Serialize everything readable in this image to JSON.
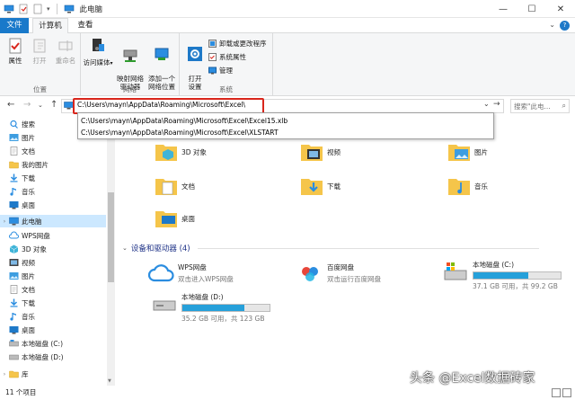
{
  "window": {
    "title": "此电脑",
    "minimize": "—",
    "maximize": "☐",
    "close": "✕"
  },
  "tabs": {
    "file": "文件",
    "computer": "计算机",
    "view": "查看",
    "help": "?"
  },
  "ribbon": {
    "location_group": "位置",
    "properties": "属性",
    "open": "打开",
    "rename": "重命名",
    "network_group": "网络",
    "access_media": "访问媒体",
    "map_drive": "映射网络\n驱动器",
    "add_location": "添加一个\n网络位置",
    "system_group": "系统",
    "open_settings": "打开\n设置",
    "uninstall": "卸载或更改程序",
    "system_props": "系统属性",
    "manage": "管理"
  },
  "address": {
    "path": "C:\\Users\\mayn\\AppData\\Roaming\\Microsoft\\Excel\\",
    "search_placeholder": "搜索\"此电...",
    "suggestions": [
      "C:\\Users\\mayn\\AppData\\Roaming\\Microsoft\\Excel\\Excel15.xlb",
      "C:\\Users\\mayn\\AppData\\Roaming\\Microsoft\\Excel\\XLSTART"
    ]
  },
  "nav": {
    "items": [
      {
        "label": "搜索",
        "icon": "search-icon"
      },
      {
        "label": "图片",
        "icon": "pictures-icon"
      },
      {
        "label": "文档",
        "icon": "documents-icon"
      },
      {
        "label": "我的图片",
        "icon": "folder-icon"
      },
      {
        "label": "下载",
        "icon": "download-icon"
      },
      {
        "label": "音乐",
        "icon": "music-icon"
      },
      {
        "label": "桌面",
        "icon": "desktop-icon"
      },
      {
        "label": "此电脑",
        "icon": "computer-icon"
      },
      {
        "label": "WPS网盘",
        "icon": "cloud-icon"
      },
      {
        "label": "3D 对象",
        "icon": "3d-objects-icon"
      },
      {
        "label": "视频",
        "icon": "video-icon"
      },
      {
        "label": "图片",
        "icon": "pictures-icon"
      },
      {
        "label": "文档",
        "icon": "documents-icon"
      },
      {
        "label": "下载",
        "icon": "download-icon"
      },
      {
        "label": "音乐",
        "icon": "music-icon"
      },
      {
        "label": "桌面",
        "icon": "desktop-icon"
      },
      {
        "label": "本地磁盘 (C:)",
        "icon": "drive-icon"
      },
      {
        "label": "本地磁盘 (D:)",
        "icon": "drive-icon"
      },
      {
        "label": "库",
        "icon": "library-icon"
      }
    ]
  },
  "folders": [
    {
      "label": "3D 对象"
    },
    {
      "label": "视频"
    },
    {
      "label": "图片"
    },
    {
      "label": "文档"
    },
    {
      "label": "下载"
    },
    {
      "label": "音乐"
    },
    {
      "label": "桌面"
    }
  ],
  "devices": {
    "header": "设备和驱动器 (4)",
    "items": [
      {
        "name": "WPS网盘",
        "sub": "双击进入WPS网盘"
      },
      {
        "name": "百度网盘",
        "sub": "双击运行百度网盘"
      },
      {
        "name": "本地磁盘 (C:)",
        "sub": "37.1 GB 可用，共 99.2 GB",
        "used_fraction": 0.63
      },
      {
        "name": "本地磁盘 (D:)",
        "sub": "35.2 GB 可用，共 123 GB",
        "used_fraction": 0.71
      }
    ]
  },
  "status": {
    "count": "11 个项目"
  },
  "watermark": "头条 @Excel数据砖家"
}
